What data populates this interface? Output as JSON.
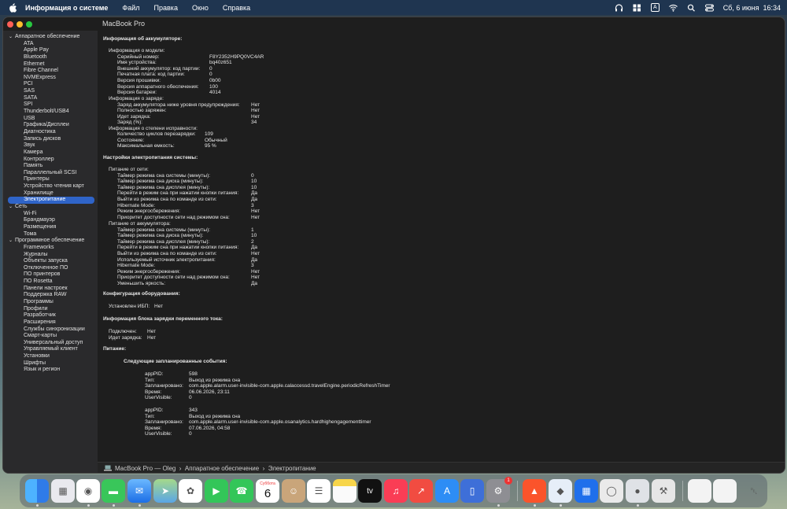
{
  "menubar": {
    "app": "Информация о системе",
    "items": [
      "Файл",
      "Правка",
      "Окно",
      "Справка"
    ],
    "input": "A",
    "datetime": "Сб, 6 июня  16:34"
  },
  "window": {
    "title": "MacBook Pro"
  },
  "sidebar": {
    "items": [
      {
        "label": "Аппаратное обеспечение",
        "level": 0,
        "expanded": true
      },
      {
        "label": "ATA",
        "level": 1
      },
      {
        "label": "Apple Pay",
        "level": 1
      },
      {
        "label": "Bluetooth",
        "level": 1
      },
      {
        "label": "Ethernet",
        "level": 1
      },
      {
        "label": "Fibre Channel",
        "level": 1
      },
      {
        "label": "NVMExpress",
        "level": 1
      },
      {
        "label": "PCI",
        "level": 1
      },
      {
        "label": "SAS",
        "level": 1
      },
      {
        "label": "SATA",
        "level": 1
      },
      {
        "label": "SPI",
        "level": 1
      },
      {
        "label": "Thunderbolt/USB4",
        "level": 1
      },
      {
        "label": "USB",
        "level": 1
      },
      {
        "label": "Графика/Дисплеи",
        "level": 1
      },
      {
        "label": "Диагностика",
        "level": 1
      },
      {
        "label": "Запись дисков",
        "level": 1
      },
      {
        "label": "Звук",
        "level": 1
      },
      {
        "label": "Камера",
        "level": 1
      },
      {
        "label": "Контроллер",
        "level": 1
      },
      {
        "label": "Память",
        "level": 1
      },
      {
        "label": "Параллельный SCSI",
        "level": 1
      },
      {
        "label": "Принтеры",
        "level": 1
      },
      {
        "label": "Устройство чтения карт",
        "level": 1
      },
      {
        "label": "Хранилище",
        "level": 1
      },
      {
        "label": "Электропитание",
        "level": 1,
        "selected": true
      },
      {
        "label": "Сеть",
        "level": 0,
        "expanded": true
      },
      {
        "label": "Wi-Fi",
        "level": 1
      },
      {
        "label": "Брандмауэр",
        "level": 1
      },
      {
        "label": "Размещения",
        "level": 1
      },
      {
        "label": "Тома",
        "level": 1
      },
      {
        "label": "Программное обеспечение",
        "level": 0,
        "expanded": true
      },
      {
        "label": "Frameworks",
        "level": 1
      },
      {
        "label": "Журналы",
        "level": 1
      },
      {
        "label": "Объекты запуска",
        "level": 1
      },
      {
        "label": "Отключенное ПО",
        "level": 1
      },
      {
        "label": "ПО принтеров",
        "level": 1
      },
      {
        "label": "ПО Rosetta",
        "level": 1
      },
      {
        "label": "Панели настроек",
        "level": 1
      },
      {
        "label": "Поддержка RAW",
        "level": 1
      },
      {
        "label": "Программы",
        "level": 1
      },
      {
        "label": "Профили",
        "level": 1
      },
      {
        "label": "Разработчик",
        "level": 1
      },
      {
        "label": "Расширения",
        "level": 1
      },
      {
        "label": "Службы синхронизации",
        "level": 1
      },
      {
        "label": "Смарт-карты",
        "level": 1
      },
      {
        "label": "Универсальный доступ",
        "level": 1
      },
      {
        "label": "Управляемый клиент",
        "level": 1
      },
      {
        "label": "Установки",
        "level": 1
      },
      {
        "label": "Шрифты",
        "level": 1
      },
      {
        "label": "Язык и регион",
        "level": 1
      }
    ]
  },
  "content": {
    "battery_heading": "Информация об аккумуляторе:",
    "model_heading": "Информация о модели:",
    "model": [
      {
        "k": "Серийный номер:",
        "v": "F8Y2352H9PQ0VC4AR"
      },
      {
        "k": "Имя устройства:",
        "v": "bq40z651"
      },
      {
        "k": "Внешний аккумулятор: код партии:",
        "v": "0"
      },
      {
        "k": "Печатная плата: код партии:",
        "v": "0"
      },
      {
        "k": "Версия прошивки:",
        "v": "0b00"
      },
      {
        "k": "Версия аппаратного обеспечения:",
        "v": "100"
      },
      {
        "k": "Версия батареи:",
        "v": "4014"
      }
    ],
    "charge_heading": "Информация о заряде:",
    "charge": [
      {
        "k": "Заряд аккумулятора ниже уровня предупреждения:",
        "v": "Нет"
      },
      {
        "k": "Полностью заряжен:",
        "v": "Нет"
      },
      {
        "k": "Идет зарядка:",
        "v": "Нет"
      },
      {
        "k": "Заряд (%):",
        "v": "34"
      }
    ],
    "health_heading": "Информация о степени исправности:",
    "health": [
      {
        "k": "Количество циклов перезарядки:",
        "v": "109"
      },
      {
        "k": "Состояние:",
        "v": "Обычный"
      },
      {
        "k": "Максимальная емкость:",
        "v": "95 %"
      }
    ],
    "power_settings_heading": "Настройки электропитания системы:",
    "ac_heading": "Питание от сети:",
    "ac": [
      {
        "k": "Таймер режима сна системы (минуты):",
        "v": "0"
      },
      {
        "k": "Таймер режима сна диска (минуты):",
        "v": "10"
      },
      {
        "k": "Таймер режима сна дисплея (минуты):",
        "v": "10"
      },
      {
        "k": "Перейти в режим сна при нажатии кнопки питания:",
        "v": "Да"
      },
      {
        "k": "Выйти из режима сна по команде из сети:",
        "v": "Да"
      },
      {
        "k": "Hibernate Mode:",
        "v": "3"
      },
      {
        "k": "Режим энергосбережения:",
        "v": "Нет"
      },
      {
        "k": "Приоритет доступности сети над режимом сна:",
        "v": "Нет"
      }
    ],
    "batt_heading": "Питание от аккумулятора:",
    "batt": [
      {
        "k": "Таймер режима сна системы (минуты):",
        "v": "1"
      },
      {
        "k": "Таймер режима сна диска (минуты):",
        "v": "10"
      },
      {
        "k": "Таймер режима сна дисплея (минуты):",
        "v": "2"
      },
      {
        "k": "Перейти в режим сна при нажатии кнопки питания:",
        "v": "Да"
      },
      {
        "k": "Выйти из режима сна по команде из сети:",
        "v": "Нет"
      },
      {
        "k": "Используемый источник электропитания:",
        "v": "Да"
      },
      {
        "k": "Hibernate Mode:",
        "v": "3"
      },
      {
        "k": "Режим энергосбережения:",
        "v": "Нет"
      },
      {
        "k": "Приоритет доступности сети над режимом сна:",
        "v": "Нет"
      },
      {
        "k": "Уменьшить яркость:",
        "v": "Да"
      }
    ],
    "hw_heading": "Конфигурация оборудования:",
    "ups": {
      "k": "Установлен ИБП:",
      "v": "Нет"
    },
    "charger_heading": "Информация блока зарядки переменного тока:",
    "charger": [
      {
        "k": "Подключен:",
        "v": "Нет"
      },
      {
        "k": "Идет зарядка:",
        "v": "Нет"
      }
    ],
    "power_heading": "Питание:",
    "events_heading": "Следующие запланированные события:",
    "events": [
      [
        {
          "k": "appPID:",
          "v": "598"
        },
        {
          "k": "Тип:",
          "v": "Выход из режима сна"
        },
        {
          "k": "Запланировано:",
          "v": "com.apple.alarm.user-invisible-com.apple.calaccessd.travelEngine.periodicRefreshTimer"
        },
        {
          "k": "Время:",
          "v": "06.06.2026, 23:11"
        },
        {
          "k": "UserVisible:",
          "v": "0"
        }
      ],
      [
        {
          "k": "appPID:",
          "v": "343"
        },
        {
          "k": "Тип:",
          "v": "Выход из режима сна"
        },
        {
          "k": "Запланировано:",
          "v": "com.apple.alarm.user-invisible-com.apple.osanalytics.hardhighengagementtimer"
        },
        {
          "k": "Время:",
          "v": "07.06.2026, 04:58"
        },
        {
          "k": "UserVisible:",
          "v": "0"
        }
      ]
    ]
  },
  "pathbar": {
    "path": "MacBook Pro — Oleg  ›  Аппаратное обеспечение  ›  Электропитание"
  },
  "dock": {
    "calendar_month": "Суббота",
    "calendar_day": "6",
    "tv_label": "tv",
    "badge": "1",
    "apps": [
      "finder-icon",
      "launchpad-icon",
      "safari-icon",
      "messages-icon",
      "mail-icon",
      "maps-icon",
      "photos-icon",
      "facetime-icon",
      "phone-icon",
      "calendar-icon",
      "contacts-icon",
      "reminders-icon",
      "notes-icon",
      "tv-icon",
      "music-icon",
      "rocket-icon",
      "appstore-icon",
      "iphone-mirroring-icon",
      "system-settings-icon",
      "brave-icon",
      "vpn-icon",
      "windows-app-icon",
      "vpn-key-icon",
      "disk-icon",
      "automator-icon",
      "document-preview-icon",
      "document-preview-icon-2",
      "trash-icon"
    ]
  }
}
